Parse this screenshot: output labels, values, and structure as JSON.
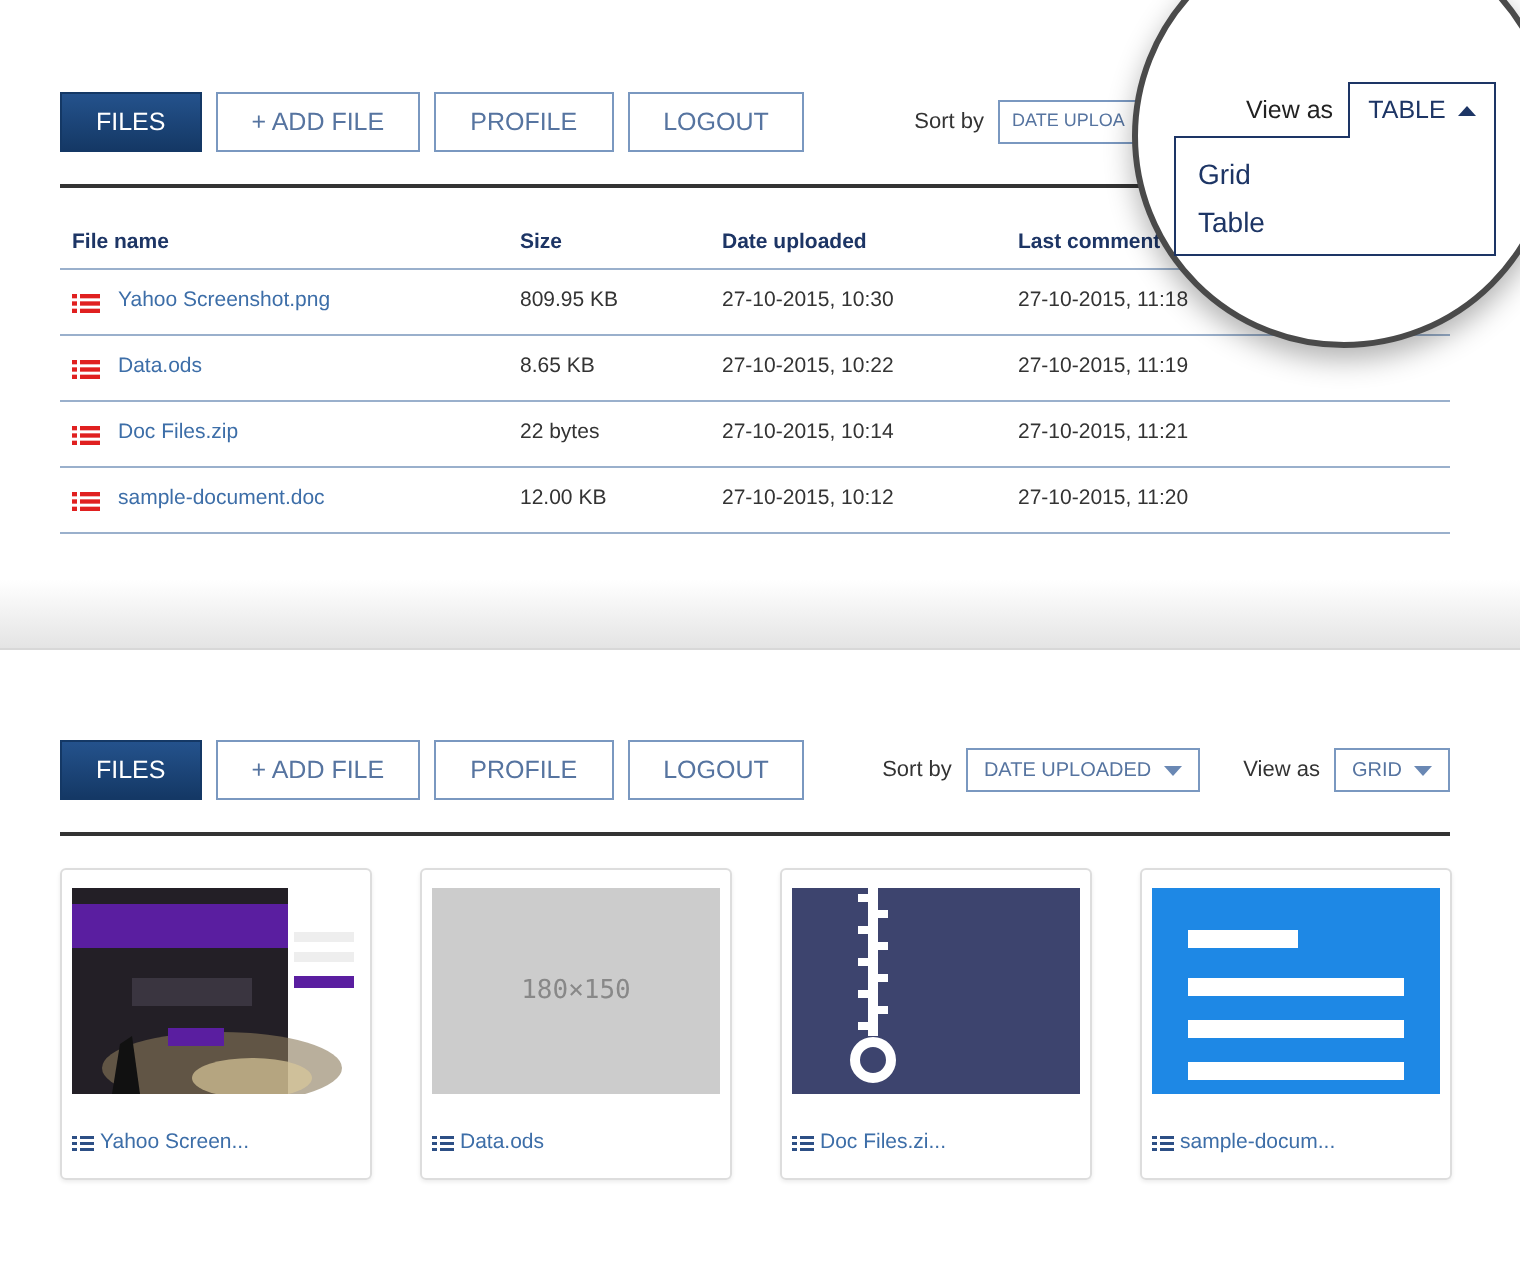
{
  "table_view": {
    "toolbar": {
      "buttons": [
        {
          "label": "FILES",
          "selected": true
        },
        {
          "label": "+ ADD FILE",
          "selected": false
        },
        {
          "label": "PROFILE",
          "selected": false
        },
        {
          "label": "LOGOUT",
          "selected": false
        }
      ],
      "sort_label": "Sort by",
      "sort_value": "DATE UPLOA",
      "view_label": "View as",
      "view_value": "TABLE",
      "view_expanded": true
    },
    "view_menu": [
      "Grid",
      "Table"
    ],
    "table": {
      "columns": [
        "File name",
        "Size",
        "Date uploaded",
        "Last comment"
      ],
      "rows": [
        [
          "Yahoo Screenshot.png",
          "809.95 KB",
          "27-10-2015, 10:30",
          "27-10-2015, 11:18"
        ],
        [
          "Data.ods",
          "8.65 KB",
          "27-10-2015, 10:22",
          "27-10-2015, 11:19"
        ],
        [
          "Doc Files.zip",
          "22 bytes",
          "27-10-2015, 10:14",
          "27-10-2015, 11:21"
        ],
        [
          "sample-document.doc",
          "12.00 KB",
          "27-10-2015, 10:12",
          "27-10-2015, 11:20"
        ]
      ]
    }
  },
  "grid_view": {
    "toolbar": {
      "buttons": [
        {
          "label": "FILES",
          "selected": true
        },
        {
          "label": "+ ADD FILE",
          "selected": false
        },
        {
          "label": "PROFILE",
          "selected": false
        },
        {
          "label": "LOGOUT",
          "selected": false
        }
      ],
      "sort_label": "Sort by",
      "sort_value": "DATE UPLOADED",
      "view_label": "View as",
      "view_value": "GRID",
      "view_expanded": false
    },
    "files": [
      {
        "kind": "picture",
        "caption": "Yahoo Screen..."
      },
      {
        "kind": "placeholder",
        "placeholder_text": "180×150",
        "caption": "Data.ods"
      },
      {
        "kind": "archive",
        "caption": "Doc Files.zi..."
      },
      {
        "kind": "document",
        "caption": "sample-docum..."
      }
    ]
  }
}
